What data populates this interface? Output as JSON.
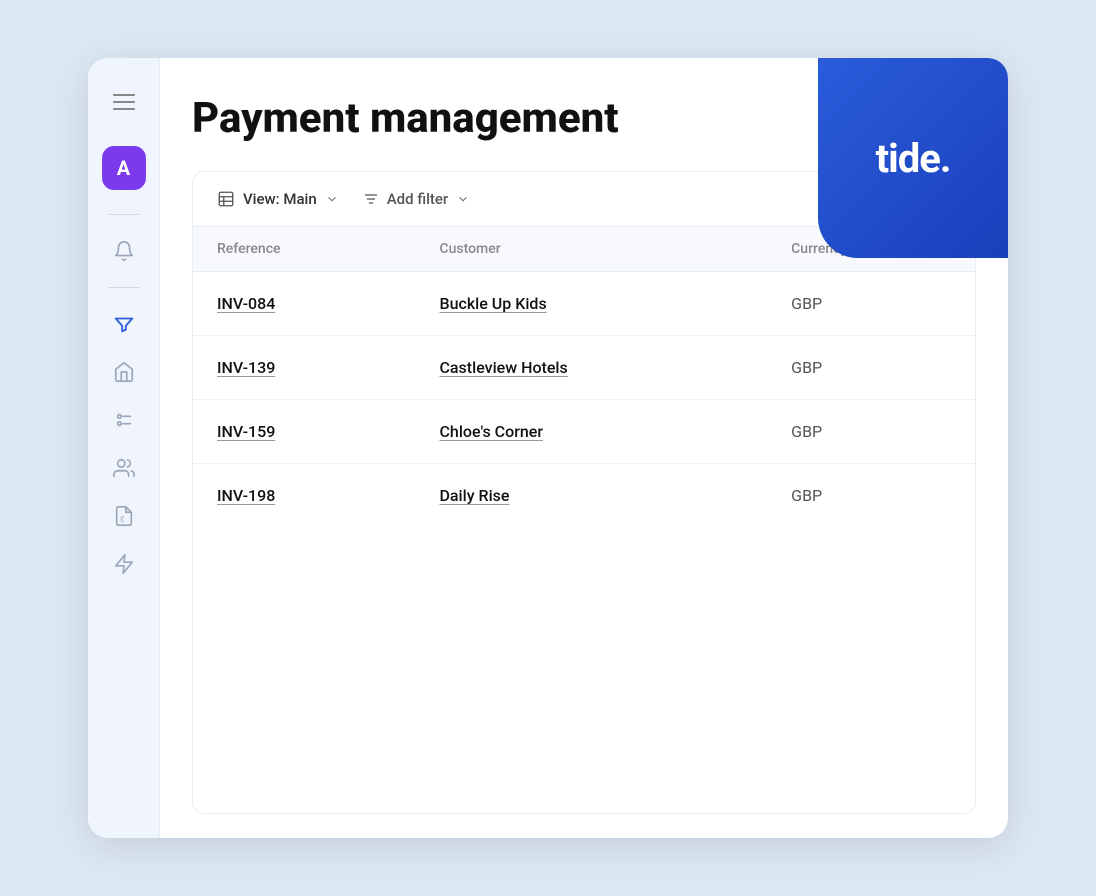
{
  "app": {
    "title": "tide.",
    "logo_dot": "."
  },
  "page": {
    "title": "Payment management"
  },
  "sidebar": {
    "avatar_label": "A",
    "menu_icon_label": "menu",
    "items": [
      {
        "name": "bell-icon",
        "label": "Notifications"
      },
      {
        "name": "filter-icon",
        "label": "Filters",
        "active": true
      },
      {
        "name": "home-icon",
        "label": "Home"
      },
      {
        "name": "list-check-icon",
        "label": "Checklist"
      },
      {
        "name": "users-icon",
        "label": "Users"
      },
      {
        "name": "document-icon",
        "label": "Documents"
      },
      {
        "name": "lightning-icon",
        "label": "Quick Actions"
      }
    ]
  },
  "toolbar": {
    "view_icon": "table-icon",
    "view_label": "View: Main",
    "filter_icon": "filter-lines-icon",
    "filter_label": "Add filter"
  },
  "table": {
    "columns": [
      {
        "key": "reference",
        "label": "Reference"
      },
      {
        "key": "customer",
        "label": "Customer"
      },
      {
        "key": "currency",
        "label": "Currency"
      }
    ],
    "rows": [
      {
        "reference": "INV-084",
        "customer": "Buckle Up Kids",
        "currency": "GBP"
      },
      {
        "reference": "INV-139",
        "customer": "Castleview Hotels",
        "currency": "GBP"
      },
      {
        "reference": "INV-159",
        "customer": "Chloe's Corner",
        "currency": "GBP"
      },
      {
        "reference": "INV-198",
        "customer": "Daily Rise",
        "currency": "GBP"
      }
    ]
  }
}
